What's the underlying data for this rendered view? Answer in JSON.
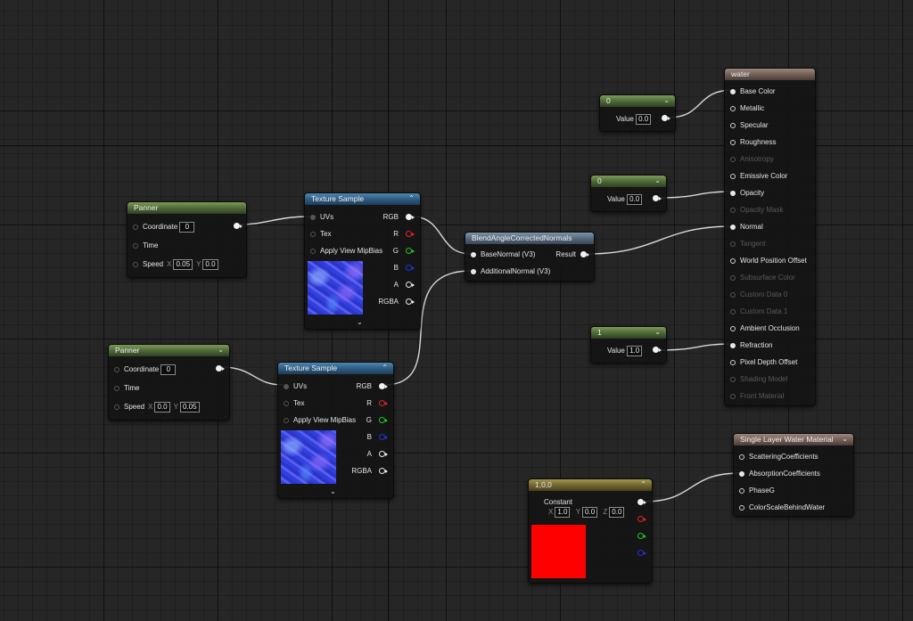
{
  "panner_top": {
    "title": "Panner",
    "coordinate_label": "Coordinate",
    "coordinate": "0",
    "time_label": "Time",
    "speed_label": "Speed",
    "x_label": "X",
    "x": "0.05",
    "y_label": "Y",
    "y": "0.0"
  },
  "panner_bottom": {
    "title": "Panner",
    "coordinate_label": "Coordinate",
    "coordinate": "0",
    "time_label": "Time",
    "speed_label": "Speed",
    "x_label": "X",
    "x": "0.0",
    "y_label": "Y",
    "y": "0.05"
  },
  "texture_top": {
    "title": "Texture Sample",
    "inputs": [
      "UVs",
      "Tex",
      "Apply View MipBias"
    ],
    "outputs": [
      "RGB",
      "R",
      "G",
      "B",
      "A",
      "RGBA"
    ]
  },
  "texture_bottom": {
    "title": "Texture Sample",
    "inputs": [
      "UVs",
      "Tex",
      "Apply View MipBias"
    ],
    "outputs": [
      "RGB",
      "R",
      "G",
      "B",
      "A",
      "RGBA"
    ]
  },
  "blend": {
    "title": "BlendAngleCorrectedNormals",
    "inputs": [
      "BaseNormal (V3)",
      "AdditionalNormal (V3)"
    ],
    "output": "Result"
  },
  "const_metallic": {
    "title": "0",
    "value_label": "Value",
    "value": "0.0"
  },
  "const_opacity": {
    "title": "0",
    "value_label": "Value",
    "value": "0.0"
  },
  "const_refraction": {
    "title": "1",
    "value_label": "Value",
    "value": "1.0"
  },
  "material": {
    "title": "water",
    "pins": [
      "Base Color",
      "Metallic",
      "Specular",
      "Roughness",
      "Anisotropy",
      "Emissive Color",
      "Opacity",
      "Opacity Mask",
      "Normal",
      "Tangent",
      "World Position Offset",
      "Subsurface Color",
      "Custom Data 0",
      "Custom Data 1",
      "Ambient Occlusion",
      "Refraction",
      "Pixel Depth Offset",
      "Shading Model",
      "Front Material"
    ]
  },
  "water_output": {
    "title": "Single Layer Water Material",
    "pins": [
      "ScatteringCoefficients",
      "AbsorptionCoefficients",
      "PhaseG",
      "ColorScaleBehindWater"
    ]
  },
  "constant3": {
    "title": "1,0,0",
    "label": "Constant",
    "x_label": "X",
    "x": "1.0",
    "y_label": "Y",
    "y": "0.0",
    "z_label": "Z",
    "z": "0.0",
    "color": "#ff0000"
  },
  "colors": {
    "pin_red": "#e02424",
    "pin_green": "#22c522",
    "pin_blue": "#2034d8"
  }
}
